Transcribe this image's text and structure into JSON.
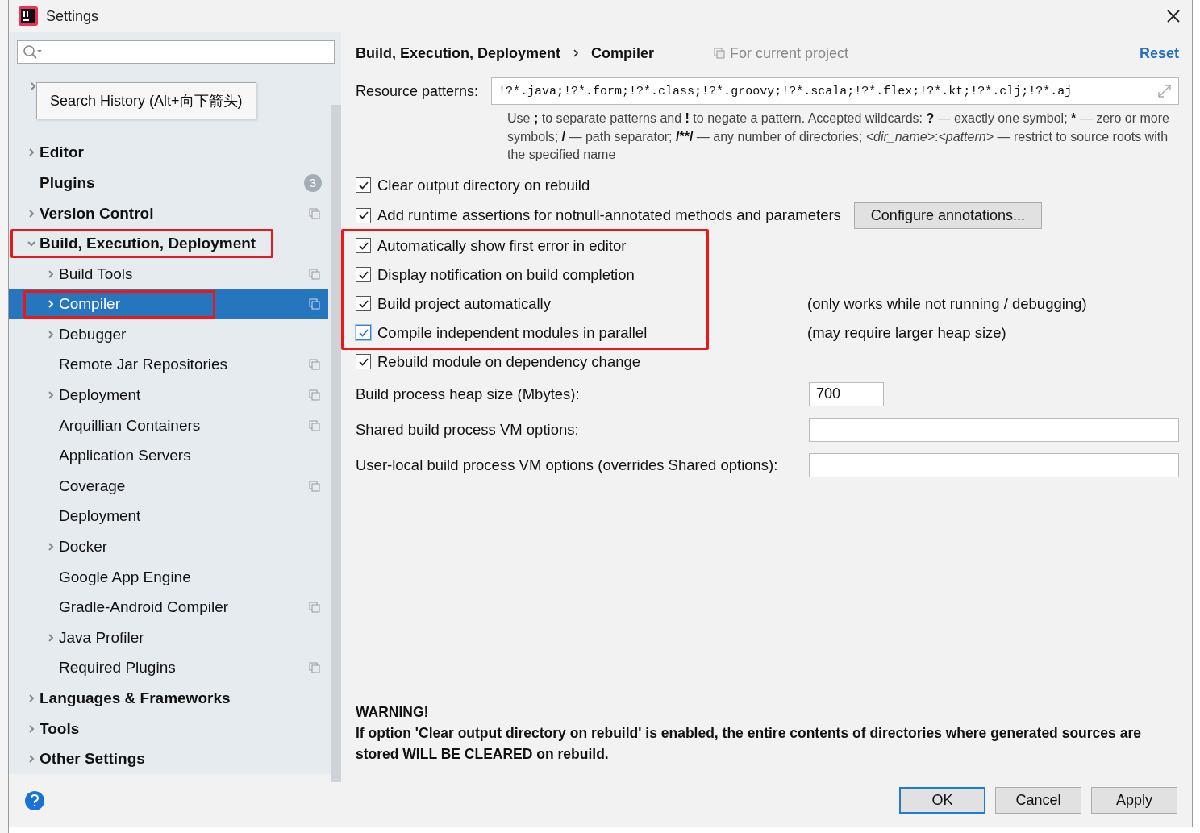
{
  "window": {
    "title": "Settings"
  },
  "search": {
    "tooltip": "Search History (Alt+向下箭头)"
  },
  "tree": [
    {
      "label": "Editor",
      "expandable": true,
      "expanded": false,
      "selected": false,
      "highlighted": false,
      "project": false
    },
    {
      "label": "Plugins",
      "expandable": false,
      "selected": false,
      "highlighted": false,
      "project": false,
      "badge": "3"
    },
    {
      "label": "Version Control",
      "expandable": true,
      "expanded": false,
      "selected": false,
      "highlighted": false,
      "project": true
    },
    {
      "label": "Build, Execution, Deployment",
      "expandable": true,
      "expanded": true,
      "selected": false,
      "highlighted": true,
      "project": false,
      "children": [
        {
          "label": "Build Tools",
          "expandable": true,
          "expanded": false,
          "selected": false,
          "highlighted": false,
          "project": true
        },
        {
          "label": "Compiler",
          "expandable": true,
          "expanded": false,
          "selected": true,
          "highlighted": true,
          "project": true
        },
        {
          "label": "Debugger",
          "expandable": true,
          "expanded": false,
          "selected": false,
          "highlighted": false,
          "project": false
        },
        {
          "label": "Remote Jar Repositories",
          "expandable": false,
          "selected": false,
          "highlighted": false,
          "project": true
        },
        {
          "label": "Deployment",
          "expandable": true,
          "expanded": false,
          "selected": false,
          "highlighted": false,
          "project": true
        },
        {
          "label": "Arquillian Containers",
          "expandable": false,
          "selected": false,
          "highlighted": false,
          "project": true
        },
        {
          "label": "Application Servers",
          "expandable": false,
          "selected": false,
          "highlighted": false,
          "project": false
        },
        {
          "label": "Coverage",
          "expandable": false,
          "selected": false,
          "highlighted": false,
          "project": true
        },
        {
          "label": "Deployment",
          "expandable": false,
          "selected": false,
          "highlighted": false,
          "project": false
        },
        {
          "label": "Docker",
          "expandable": true,
          "expanded": false,
          "selected": false,
          "highlighted": false,
          "project": false
        },
        {
          "label": "Google App Engine",
          "expandable": false,
          "selected": false,
          "highlighted": false,
          "project": false
        },
        {
          "label": "Gradle-Android Compiler",
          "expandable": false,
          "selected": false,
          "highlighted": false,
          "project": true
        },
        {
          "label": "Java Profiler",
          "expandable": true,
          "expanded": false,
          "selected": false,
          "highlighted": false,
          "project": false
        },
        {
          "label": "Required Plugins",
          "expandable": false,
          "selected": false,
          "highlighted": false,
          "project": true
        }
      ]
    },
    {
      "label": "Languages & Frameworks",
      "expandable": true,
      "expanded": false,
      "selected": false,
      "highlighted": false,
      "project": false
    },
    {
      "label": "Tools",
      "expandable": true,
      "expanded": false,
      "selected": false,
      "highlighted": false,
      "project": false
    },
    {
      "label": "Other Settings",
      "expandable": true,
      "expanded": false,
      "selected": false,
      "highlighted": false,
      "project": false
    }
  ],
  "breadcrumb": [
    "Build, Execution, Deployment",
    "Compiler"
  ],
  "scope": "For current project",
  "reset": "Reset",
  "resource_patterns": {
    "label": "Resource patterns:",
    "value": "!?*.java;!?*.form;!?*.class;!?*.groovy;!?*.scala;!?*.flex;!?*.kt;!?*.clj;!?*.aj",
    "hint": [
      {
        "text": "Use ",
        "kind": "text"
      },
      {
        "text": ";",
        "kind": "symbol"
      },
      {
        "text": " to separate patterns and ",
        "kind": "text"
      },
      {
        "text": "!",
        "kind": "symbol"
      },
      {
        "text": " to negate a pattern. Accepted wildcards: ",
        "kind": "text"
      },
      {
        "text": "?",
        "kind": "symbol"
      },
      {
        "text": " — exactly one symbol; ",
        "kind": "text"
      },
      {
        "text": "*",
        "kind": "symbol"
      },
      {
        "text": " — zero or more symbols; ",
        "kind": "text"
      },
      {
        "text": "/",
        "kind": "symbol"
      },
      {
        "text": " — path separator; ",
        "kind": "text"
      },
      {
        "text": "/**/",
        "kind": "symbol"
      },
      {
        "text": " — any number of directories; ",
        "kind": "text"
      },
      {
        "text": "<dir_name>",
        "kind": "placeholder"
      },
      {
        "text": ":",
        "kind": "text"
      },
      {
        "text": "<pattern>",
        "kind": "placeholder"
      },
      {
        "text": " — restrict to source roots with the specified name",
        "kind": "text"
      }
    ]
  },
  "options": [
    {
      "label": "Clear output directory on rebuild",
      "checked": true,
      "focused": false,
      "highlighted": false
    },
    {
      "label": "Add runtime assertions for notnull-annotated methods and parameters",
      "checked": true,
      "focused": false,
      "highlighted": false,
      "button": "Configure annotations..."
    },
    {
      "label": "Automatically show first error in editor",
      "checked": true,
      "focused": false,
      "highlighted": true
    },
    {
      "label": "Display notification on build completion",
      "checked": true,
      "focused": false,
      "highlighted": true
    },
    {
      "label": "Build project automatically",
      "checked": true,
      "focused": false,
      "highlighted": true,
      "note": "(only works while not running / debugging)"
    },
    {
      "label": "Compile independent modules in parallel",
      "checked": true,
      "focused": true,
      "highlighted": true,
      "note": "(may require larger heap size)"
    },
    {
      "label": "Rebuild module on dependency change",
      "checked": true,
      "focused": false,
      "highlighted": false
    }
  ],
  "fields": [
    {
      "label": "Build process heap size (Mbytes):",
      "value": "700",
      "kind": "short"
    },
    {
      "label": "Shared build process VM options:",
      "kind": "wide"
    },
    {
      "label": "User-local build process VM options (overrides Shared options):",
      "kind": "wide"
    }
  ],
  "warning": {
    "title": "WARNING!",
    "text": "If option 'Clear output directory on rebuild' is enabled, the entire contents of directories where generated sources are stored WILL BE CLEARED on rebuild."
  },
  "buttons": [
    {
      "label": "OK",
      "default": true
    },
    {
      "label": "Cancel",
      "default": false
    },
    {
      "label": "Apply",
      "default": false
    }
  ]
}
